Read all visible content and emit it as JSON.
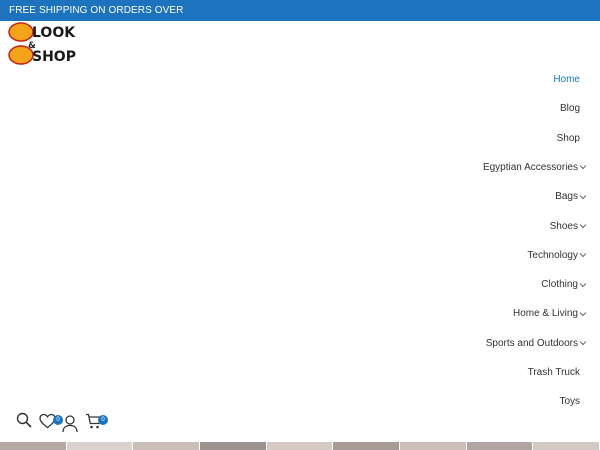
{
  "topbar": {
    "text": "FREE SHIPPING ON ORDERS OVER"
  },
  "logo": {
    "line1": "LOOK",
    "amp": "&",
    "line2": "SHOP",
    "accent": "#f5a31a",
    "ink": "#1a1a1a"
  },
  "nav": {
    "items": [
      {
        "label": "Home",
        "active": true,
        "dropdown": false
      },
      {
        "label": "Blog",
        "active": false,
        "dropdown": false
      },
      {
        "label": "Shop",
        "active": false,
        "dropdown": false
      },
      {
        "label": "Egyptian Accessories",
        "active": false,
        "dropdown": true
      },
      {
        "label": "Bags",
        "active": false,
        "dropdown": true
      },
      {
        "label": "Shoes",
        "active": false,
        "dropdown": true
      },
      {
        "label": "Technology",
        "active": false,
        "dropdown": true
      },
      {
        "label": "Clothing",
        "active": false,
        "dropdown": true
      },
      {
        "label": "Home & Living",
        "active": false,
        "dropdown": true
      },
      {
        "label": "Sports and Outdoors",
        "active": false,
        "dropdown": true
      },
      {
        "label": "Trash Truck",
        "active": false,
        "dropdown": false
      },
      {
        "label": "Toys",
        "active": false,
        "dropdown": false
      }
    ]
  },
  "header_icons": {
    "wishlist_count": "0",
    "cart_count": "0"
  },
  "colors": {
    "brand": "#1e73be",
    "text": "#333333"
  }
}
